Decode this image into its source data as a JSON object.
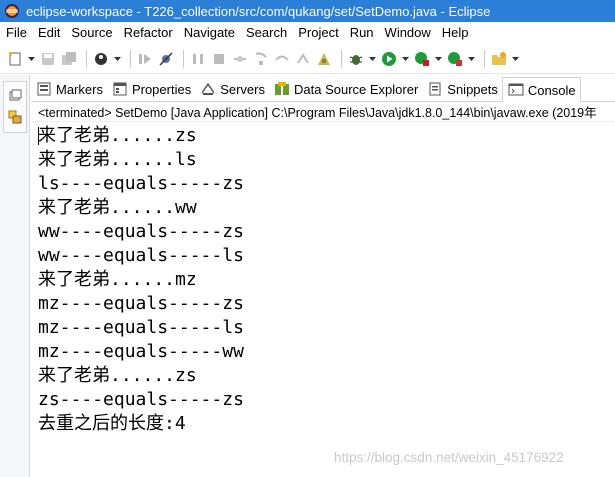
{
  "window": {
    "title": "eclipse-workspace - T226_collection/src/com/qukang/set/SetDemo.java - Eclipse",
    "icon": "eclipse-icon"
  },
  "menu": {
    "items": [
      "File",
      "Edit",
      "Source",
      "Refactor",
      "Navigate",
      "Search",
      "Project",
      "Run",
      "Window",
      "Help"
    ]
  },
  "toolbar": {
    "icons": [
      "new-icon",
      "save-icon",
      "save-all-icon",
      "debug-skip-icon",
      "skip-breakpoints-icon",
      "resume-icon",
      "suspend-icon",
      "terminate-icon",
      "step-into-icon",
      "debug-icon",
      "run-icon",
      "coverage-icon",
      "external-tools-icon",
      "new-folder-icon"
    ]
  },
  "tabs": [
    {
      "label": "Markers",
      "icon": "markers-icon",
      "active": false
    },
    {
      "label": "Properties",
      "icon": "properties-icon",
      "active": false
    },
    {
      "label": "Servers",
      "icon": "servers-icon",
      "active": false
    },
    {
      "label": "Data Source Explorer",
      "icon": "data-source-icon",
      "active": false
    },
    {
      "label": "Snippets",
      "icon": "snippets-icon",
      "active": false
    },
    {
      "label": "Console",
      "icon": "console-icon",
      "active": true
    }
  ],
  "console": {
    "header": "<terminated> SetDemo [Java Application] C:\\Program Files\\Java\\jdk1.8.0_144\\bin\\javaw.exe (2019年",
    "lines": [
      "来了老弟......zs",
      "来了老弟......ls",
      "ls----equals-----zs",
      "来了老弟......ww",
      "ww----equals-----zs",
      "ww----equals-----ls",
      "来了老弟......mz",
      "mz----equals-----zs",
      "mz----equals-----ls",
      "mz----equals-----ww",
      "来了老弟......zs",
      "zs----equals-----zs",
      "去重之后的长度:4"
    ]
  },
  "watermark": "https://blog.csdn.net/weixin_45176922",
  "colors": {
    "titlebar": "#2b7fd6",
    "background": "#ffffff",
    "text": "#000000"
  }
}
